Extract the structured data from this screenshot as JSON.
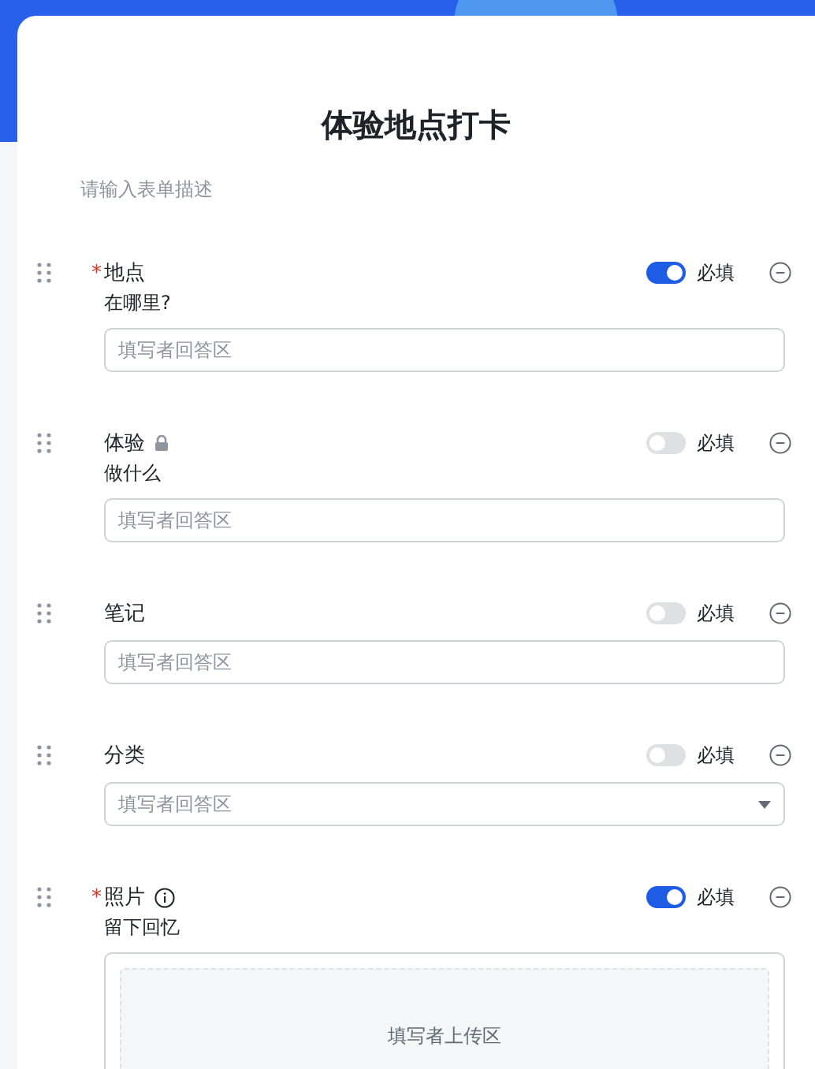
{
  "form": {
    "title": "体验地点打卡",
    "description_placeholder": "请输入表单描述"
  },
  "fields": [
    {
      "kind": "text",
      "mark": "*",
      "label": "地点",
      "required": true,
      "hint": "在哪里?",
      "placeholder": "填写者回答区",
      "required_label": "必填"
    },
    {
      "kind": "text",
      "label": "体验",
      "required": false,
      "locked": true,
      "hint": "做什么",
      "placeholder": "填写者回答区",
      "required_label": "必填"
    },
    {
      "kind": "text",
      "label": "笔记",
      "required": false,
      "placeholder": "填写者回答区",
      "required_label": "必填"
    },
    {
      "kind": "select",
      "label": "分类",
      "required": false,
      "placeholder": "填写者回答区",
      "required_label": "必填"
    },
    {
      "kind": "upload",
      "mark": "*",
      "label": "照片",
      "required": true,
      "info": true,
      "hint": "留下回忆",
      "placeholder": "填写者上传区",
      "required_label": "必填"
    }
  ]
}
